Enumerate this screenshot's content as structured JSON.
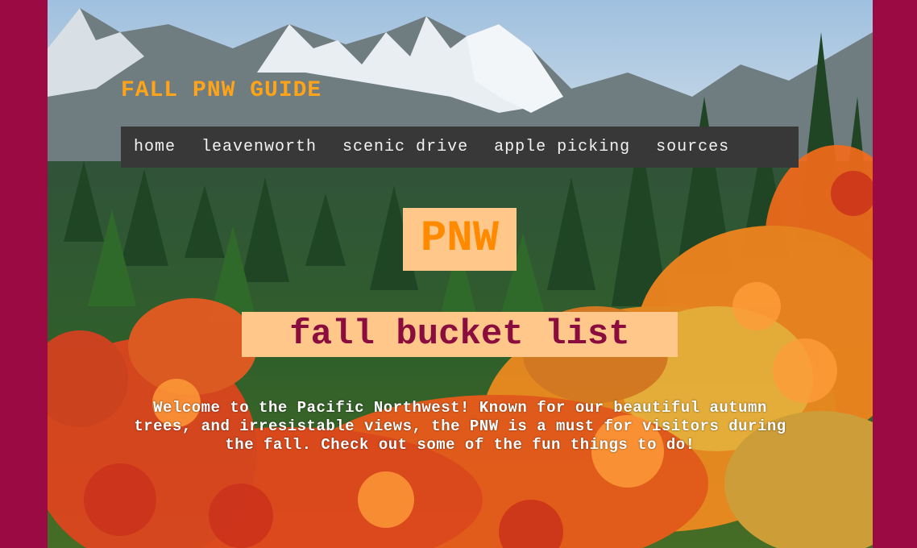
{
  "site": {
    "title": "FALL PNW GUIDE"
  },
  "nav": {
    "items": [
      {
        "label": "home"
      },
      {
        "label": "leavenworth"
      },
      {
        "label": "scenic drive"
      },
      {
        "label": "apple picking"
      },
      {
        "label": "sources"
      }
    ]
  },
  "hero": {
    "title": "PNW",
    "subtitle": "fall bucket list",
    "intro": "Welcome to the Pacific Northwest! Known for our beautiful autumn trees, and irresistable views, the PNW is a must for visitors during the fall. Check out some of the fun things to do!"
  },
  "colors": {
    "page_border": "#9c0a44",
    "title_orange": "#ffa319",
    "nav_background": "#383838",
    "label_background": "#ffc78a",
    "hero_orange": "#ff8a00",
    "subtitle_maroon": "#8a0d3d"
  },
  "background": {
    "description": "mountain-forest-fall-foliage-photo"
  }
}
